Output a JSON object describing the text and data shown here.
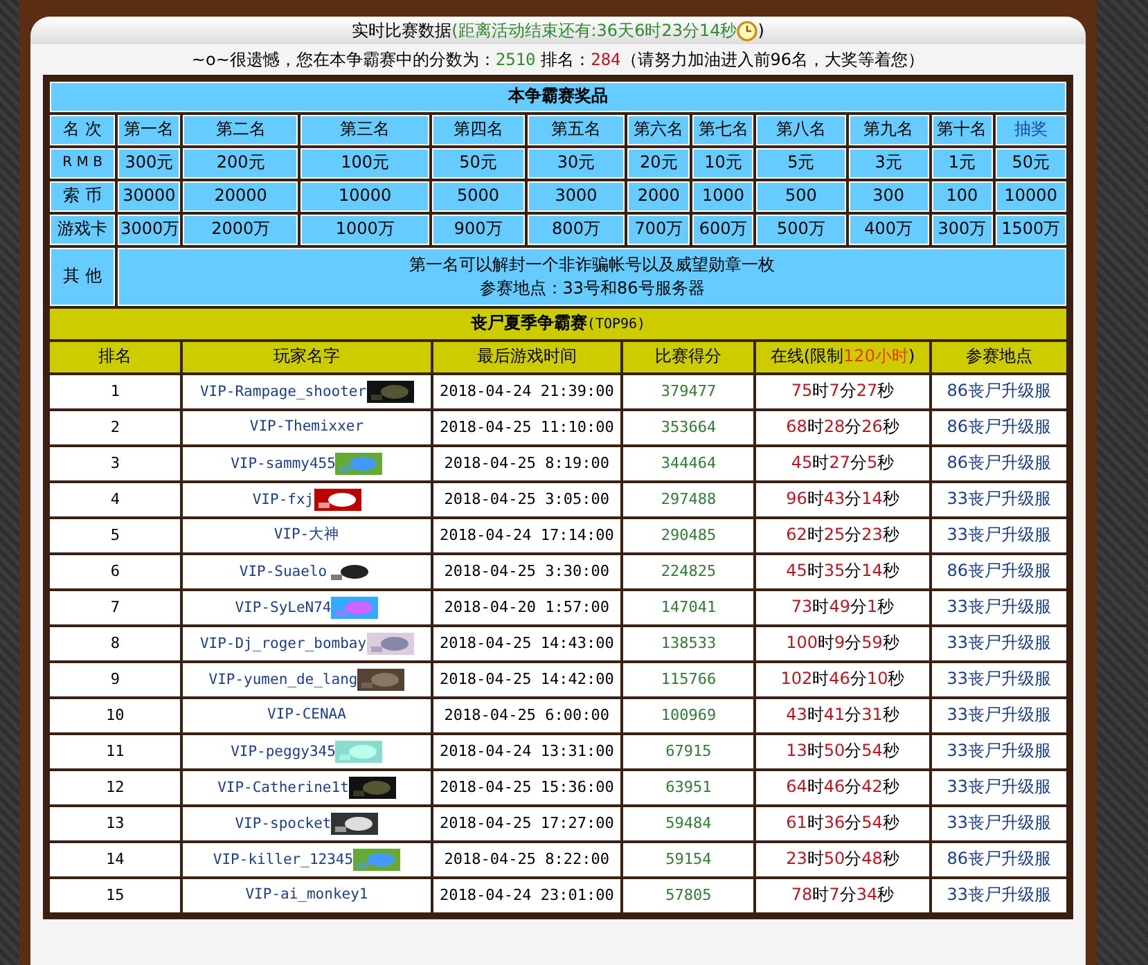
{
  "header": {
    "title": "实时比赛数据",
    "countdown_open": "(",
    "countdown_label": "距离活动结束还有:",
    "countdown": "36天6时23分14秒",
    "countdown_close": ")"
  },
  "notice": {
    "prefix": "~o~很遗憾，您在本争霸赛中的分数为：",
    "score": "2510",
    "rank_label": "排名：",
    "rank": "284",
    "suffix": "（请努力加油进入前96名，大奖等着您）"
  },
  "prizes": {
    "title": "本争霸赛奖品",
    "corner": "名 次",
    "columns": [
      {
        "label": "第一名",
        "kind": "text"
      },
      {
        "label": "第二名",
        "kind": "text"
      },
      {
        "label": "第三名",
        "kind": "text"
      },
      {
        "label": "第四名",
        "kind": "text"
      },
      {
        "label": "第五名",
        "kind": "text"
      },
      {
        "label": "第六名",
        "kind": "text"
      },
      {
        "label": "第七名",
        "kind": "text"
      },
      {
        "label": "第八名",
        "kind": "text"
      },
      {
        "label": "第九名",
        "kind": "text"
      },
      {
        "label": "第十名",
        "kind": "text"
      },
      {
        "label": "抽奖",
        "kind": "link"
      }
    ],
    "rows": [
      {
        "label": "R M B",
        "cells": [
          "300元",
          "200元",
          "100元",
          "50元",
          "30元",
          "20元",
          "10元",
          "5元",
          "3元",
          "1元",
          "50元"
        ]
      },
      {
        "label": "索 币",
        "cells": [
          "30000",
          "20000",
          "10000",
          "5000",
          "3000",
          "2000",
          "1000",
          "500",
          "300",
          "100",
          "10000"
        ]
      },
      {
        "label": "游戏卡",
        "cells": [
          "3000万",
          "2000万",
          "1000万",
          "900万",
          "800万",
          "700万",
          "600万",
          "500万",
          "400万",
          "300万",
          "1500万"
        ]
      }
    ],
    "other": {
      "label": "其 他",
      "lines": [
        "第一名可以解封一个非诈骗帐号以及威望勋章一枚",
        "参赛地点：33号和86号服务器"
      ]
    }
  },
  "ranking": {
    "title": "丧尸夏季争霸赛",
    "subtitle": "(TOP96)",
    "columns": [
      {
        "label": "排名"
      },
      {
        "label": "玩家名字"
      },
      {
        "label": "最后游戏时间"
      },
      {
        "label": "比赛得分"
      },
      {
        "label": "在线(限制",
        "highlight": "120小时",
        "suffix": ")"
      },
      {
        "label": "参赛地点"
      }
    ],
    "rows": [
      {
        "rank": "1",
        "name": "VIP-Rampage_shooter",
        "badge": true,
        "time": "2018-04-24 21:39:00",
        "score": "379477",
        "online": "75时7分27秒",
        "site": "86丧尸升级服"
      },
      {
        "rank": "2",
        "name": "VIP-Themixxer",
        "badge": false,
        "time": "2018-04-25 11:10:00",
        "score": "353664",
        "online": "68时28分26秒",
        "site": "86丧尸升级服"
      },
      {
        "rank": "3",
        "name": "VIP-sammy455",
        "badge": true,
        "time": "2018-04-25 8:19:00",
        "score": "344464",
        "online": "45时27分5秒",
        "site": "86丧尸升级服"
      },
      {
        "rank": "4",
        "name": "VIP-fxj",
        "badge": true,
        "time": "2018-04-25 3:05:00",
        "score": "297488",
        "online": "96时43分14秒",
        "site": "33丧尸升级服"
      },
      {
        "rank": "5",
        "name": "VIP-大神",
        "badge": false,
        "time": "2018-04-24 17:14:00",
        "score": "290485",
        "online": "62时25分23秒",
        "site": "33丧尸升级服"
      },
      {
        "rank": "6",
        "name": "VIP-Suaelo",
        "badge": true,
        "time": "2018-04-25 3:30:00",
        "score": "224825",
        "online": "45时35分14秒",
        "site": "86丧尸升级服"
      },
      {
        "rank": "7",
        "name": "VIP-SyLeN74",
        "badge": true,
        "time": "2018-04-20 1:57:00",
        "score": "147041",
        "online": "73时49分1秒",
        "site": "33丧尸升级服"
      },
      {
        "rank": "8",
        "name": "VIP-Dj_roger_bombay",
        "badge": true,
        "time": "2018-04-25 14:43:00",
        "score": "138533",
        "online": "100时9分59秒",
        "site": "33丧尸升级服"
      },
      {
        "rank": "9",
        "name": "VIP-yumen_de_lang",
        "badge": true,
        "time": "2018-04-25 14:42:00",
        "score": "115766",
        "online": "102时46分10秒",
        "site": "33丧尸升级服"
      },
      {
        "rank": "10",
        "name": "VIP-CENAA",
        "badge": false,
        "time": "2018-04-25 6:00:00",
        "score": "100969",
        "online": "43时41分31秒",
        "site": "33丧尸升级服"
      },
      {
        "rank": "11",
        "name": "VIP-peggy345",
        "badge": true,
        "time": "2018-04-24 13:31:00",
        "score": "67915",
        "online": "13时50分54秒",
        "site": "33丧尸升级服"
      },
      {
        "rank": "12",
        "name": "VIP-Catherine1t",
        "badge": true,
        "time": "2018-04-25 15:36:00",
        "score": "63951",
        "online": "64时46分42秒",
        "site": "33丧尸升级服"
      },
      {
        "rank": "13",
        "name": "VIP-spocket",
        "badge": true,
        "time": "2018-04-25 17:27:00",
        "score": "59484",
        "online": "61时36分54秒",
        "site": "33丧尸升级服"
      },
      {
        "rank": "14",
        "name": "VIP-killer_12345",
        "badge": true,
        "time": "2018-04-25 8:22:00",
        "score": "59154",
        "online": "23时50分48秒",
        "site": "86丧尸升级服"
      },
      {
        "rank": "15",
        "name": "VIP-ai_monkey1",
        "badge": false,
        "time": "2018-04-24 23:01:00",
        "score": "57805",
        "online": "78时7分34秒",
        "site": "33丧尸升级服"
      }
    ]
  }
}
